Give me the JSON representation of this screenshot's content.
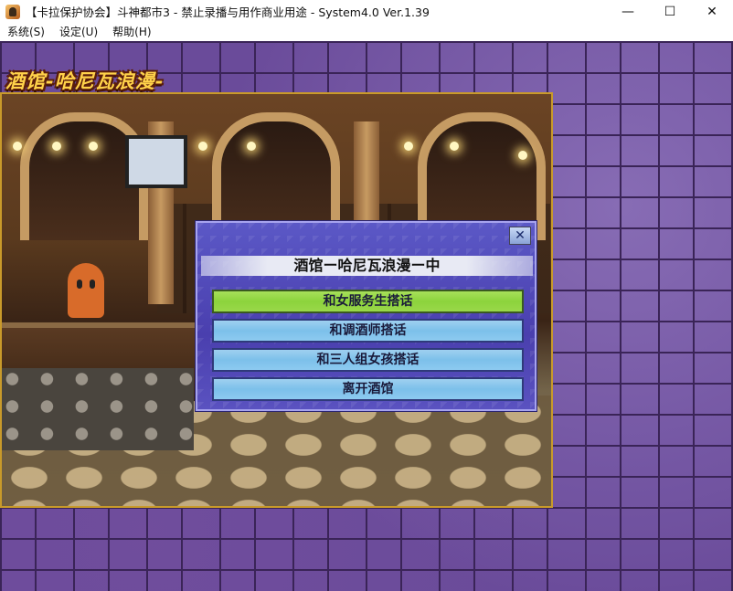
{
  "window": {
    "title": "【卡拉保护协会】斗神都市3 - 禁止录播与用作商业用途 - System4.0 Ver.1.39",
    "minimize_glyph": "—",
    "maximize_glyph": "☐",
    "close_glyph": "✕"
  },
  "menu": {
    "items": [
      {
        "label": "系统(S)"
      },
      {
        "label": "设定(U)"
      },
      {
        "label": "帮助(H)"
      }
    ]
  },
  "location": {
    "title": "酒馆-哈尼瓦浪漫-"
  },
  "dialog": {
    "title": "酒馆ー哈尼瓦浪漫ー中",
    "close_glyph": "✕",
    "options": [
      {
        "label": "和女服务生搭话",
        "selected": true
      },
      {
        "label": "和调酒师搭话",
        "selected": false
      },
      {
        "label": "和三人组女孩搭话",
        "selected": false
      },
      {
        "label": "离开酒馆",
        "selected": false
      }
    ],
    "colors": {
      "selected": "#8cd33c",
      "option": "#7cc0ea",
      "panel": "#4a3fae"
    }
  }
}
